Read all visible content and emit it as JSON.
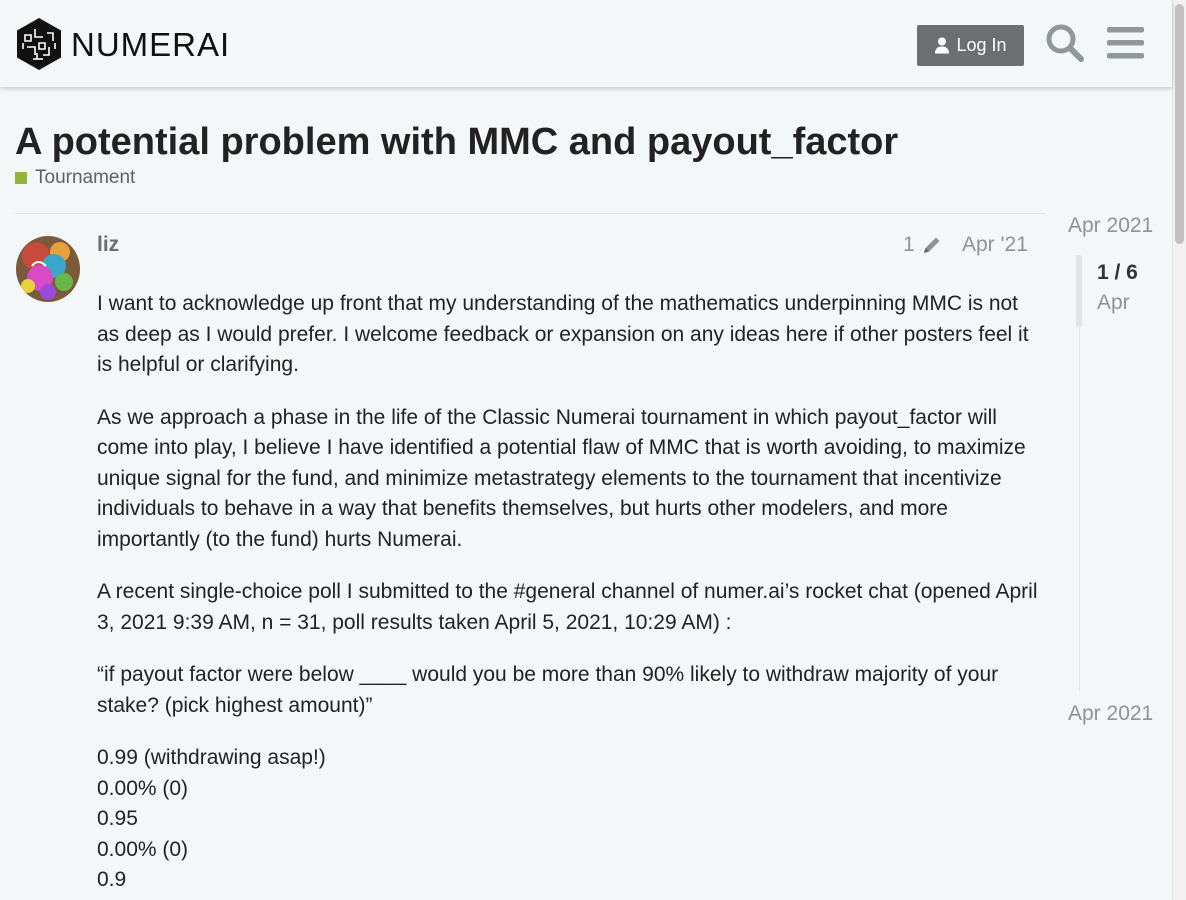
{
  "header": {
    "logo_text": "NUMERAI",
    "login_label": "Log In",
    "search_icon": "search-icon",
    "menu_icon": "hamburger-menu-icon"
  },
  "topic": {
    "title": "A potential problem with MMC and payout_factor",
    "category": "Tournament",
    "category_color": "#92b43a"
  },
  "post": {
    "username": "liz",
    "edit_count": "1",
    "date": "Apr '21",
    "paragraphs": [
      "I want to acknowledge up front that my understanding of the mathematics underpinning MMC is not as deep as I would prefer. I welcome feedback or expansion on any ideas here if other posters feel it is helpful or clarifying.",
      "As we approach a phase in the life of the Classic Numerai tournament in which payout_factor will come into play, I believe I have identified a potential flaw of MMC that is worth avoiding, to maximize unique signal for the fund, and minimize metastrategy elements to the tournament that incentivize individuals to behave in a way that benefits themselves, but hurts other modelers, and more importantly (to the fund) hurts Numerai.",
      "A recent single-choice poll I submitted to the #general channel of numer.ai’s rocket chat (opened April 3, 2021 9:39 AM, n = 31, poll results taken April 5, 2021, 10:29 AM) :",
      "“if payout factor were below ____ would you be more than 90% likely to withdraw majority of your stake? (pick highest amount)”"
    ],
    "poll_lines": [
      "0.99 (withdrawing asap!)",
      "0.00% (0)",
      "0.95",
      "0.00% (0)",
      "0.9"
    ]
  },
  "timeline": {
    "top_date": "Apr 2021",
    "position": "1 / 6",
    "position_sub": "Apr",
    "bottom_date": "Apr 2021"
  }
}
